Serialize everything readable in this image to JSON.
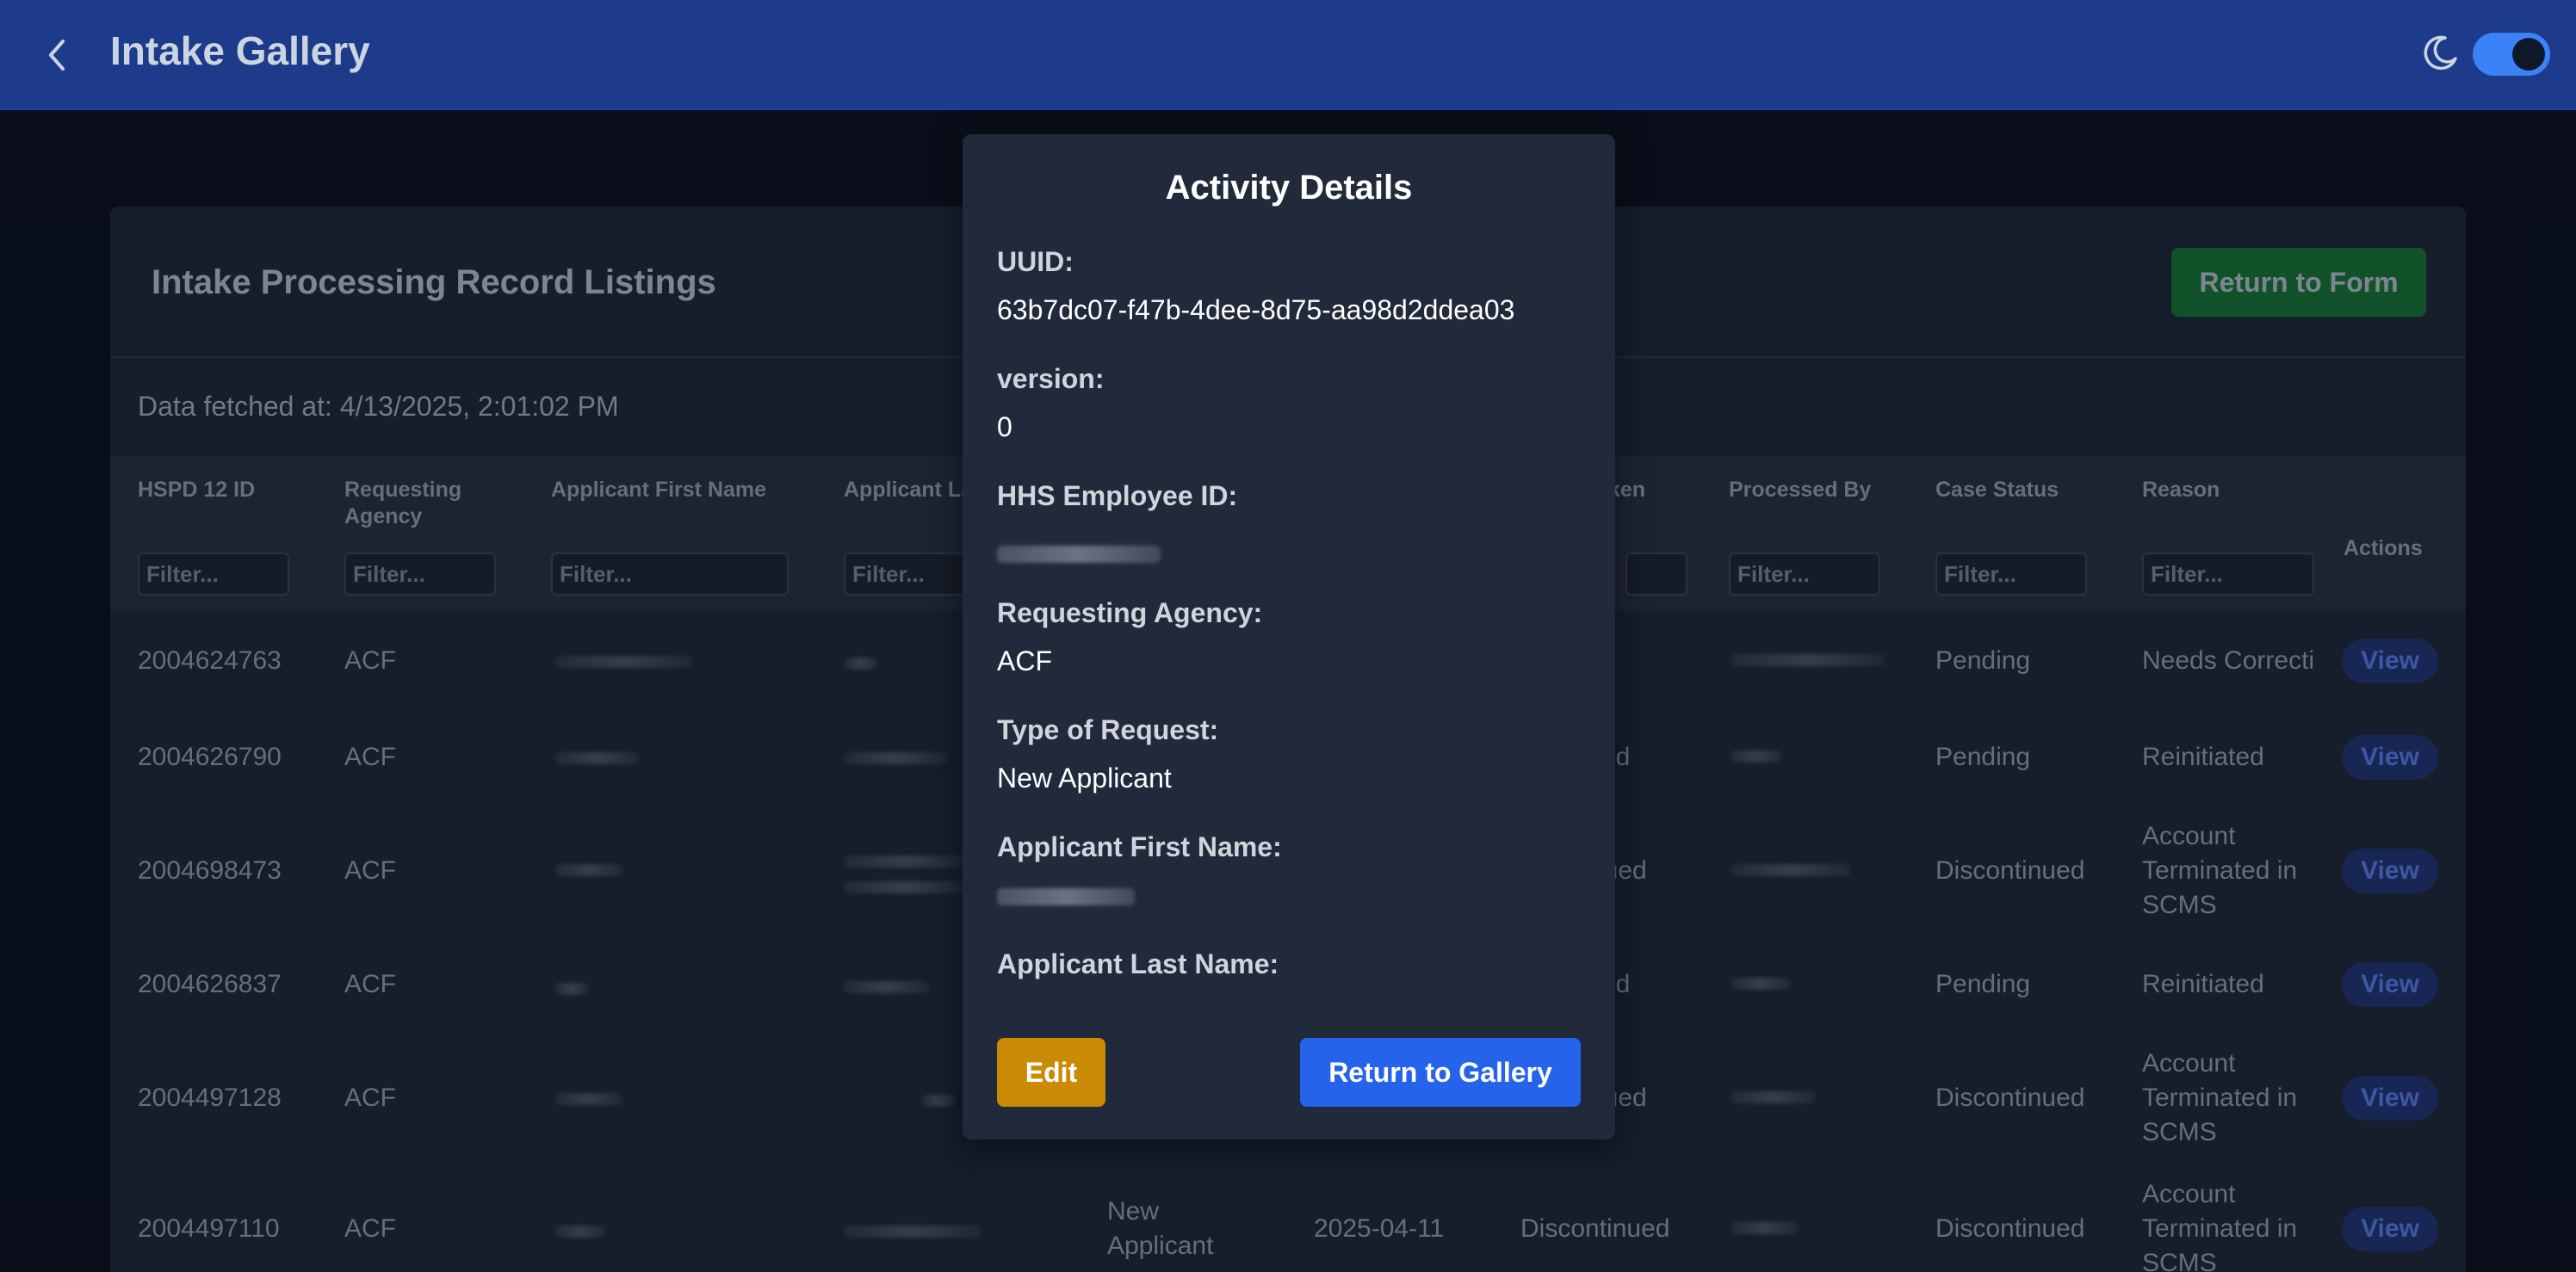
{
  "header": {
    "title": "Intake Gallery",
    "back_icon": "chevron-left-icon",
    "theme_icon": "moon-icon",
    "dark_mode_on": true
  },
  "page": {
    "card_title": "Intake Processing Record Listings",
    "return_to_form_label": "Return to Form",
    "fetched_at": "Data fetched at: 4/13/2025, 2:01:02 PM"
  },
  "table": {
    "columns": [
      "HSPD 12 ID",
      "Requesting Agency",
      "Applicant First Name",
      "Applicant La",
      "ken",
      "Processed By",
      "Case Status",
      "Reason",
      "Actions"
    ],
    "filter_placeholder": "Filter...",
    "view_label": "View",
    "rows": [
      {
        "id": "2004624763",
        "agency": "ACF",
        "request": "",
        "date": "",
        "activity": "",
        "status": "Pending",
        "reason": "Needs Correctio"
      },
      {
        "id": "2004626790",
        "agency": "ACF",
        "request": "",
        "date": "",
        "activity": "ed",
        "status": "Pending",
        "reason": "Reinitiated"
      },
      {
        "id": "2004698473",
        "agency": "ACF",
        "request": "",
        "date": "",
        "activity": "nued",
        "status": "Discontinued",
        "reason": "Account Terminated in SCMS"
      },
      {
        "id": "2004626837",
        "agency": "ACF",
        "request": "",
        "date": "",
        "activity": "ed",
        "status": "Pending",
        "reason": "Reinitiated"
      },
      {
        "id": "2004497128",
        "agency": "ACF",
        "request": "",
        "date": "",
        "activity": "nued",
        "status": "Discontinued",
        "reason": "Account Terminated in SCMS"
      },
      {
        "id": "2004497110",
        "agency": "ACF",
        "request": "New Applicant",
        "date": "2025-04-11",
        "activity": "Discontinued",
        "status": "Discontinued",
        "reason": "Account Terminated in SCMS"
      }
    ]
  },
  "modal": {
    "title": "Activity Details",
    "fields": [
      {
        "label": "UUID:",
        "value": "63b7dc07-f47b-4dee-8d75-aa98d2ddea03"
      },
      {
        "label": "version:",
        "value": "0"
      },
      {
        "label": "HHS Employee ID:",
        "value": ""
      },
      {
        "label": "Requesting Agency:",
        "value": "ACF"
      },
      {
        "label": "Type of Request:",
        "value": "New Applicant"
      },
      {
        "label": "Applicant First Name:",
        "value": ""
      },
      {
        "label": "Applicant Last Name:",
        "value": ""
      }
    ],
    "edit_label": "Edit",
    "return_label": "Return to Gallery"
  }
}
